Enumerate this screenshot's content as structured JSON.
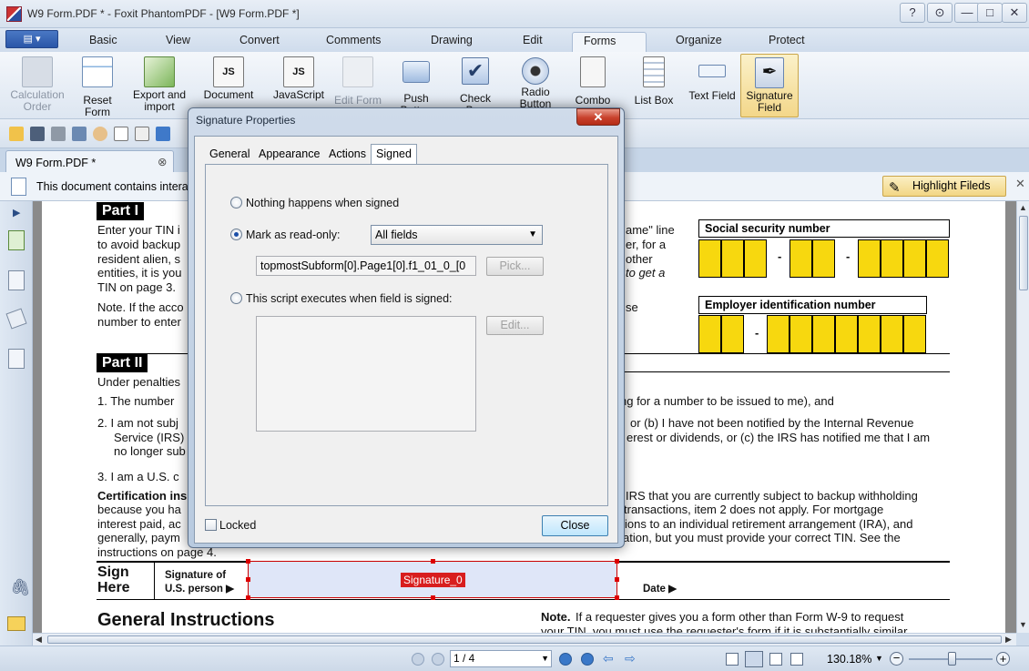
{
  "window": {
    "title": "W9 Form.PDF * - Foxit PhantomPDF - [W9 Form.PDF *]",
    "help": "?",
    "restore_small": "⊙",
    "minimize": "—",
    "maximize": "□",
    "close": "✕"
  },
  "menu": {
    "app_button": "▤ ▾",
    "tabs": [
      "Basic",
      "View",
      "Convert",
      "Comments",
      "Drawing",
      "Edit",
      "Forms",
      "Organize",
      "Protect"
    ],
    "active": "Forms"
  },
  "ribbon": [
    {
      "label": "Calculation Order",
      "icon": "calculation-order-icon",
      "disabled": true
    },
    {
      "label": "Reset Form",
      "icon": "reset-form-icon"
    },
    {
      "label": "Export and import",
      "icon": "export-import-icon"
    },
    {
      "label": "Document JavaScript",
      "icon": "document-js-icon"
    },
    {
      "label": "JavaScript Console",
      "icon": "javascript-icon"
    },
    {
      "label": "Edit Form",
      "icon": "edit-form-icon",
      "disabled": true
    },
    {
      "label": "Push Button",
      "icon": "push-button-icon"
    },
    {
      "label": "Check Box",
      "icon": "check-box-icon"
    },
    {
      "label": "Radio Button",
      "icon": "radio-button-icon"
    },
    {
      "label": "Combo Box",
      "icon": "combo-box-icon"
    },
    {
      "label": "List Box",
      "icon": "list-box-icon"
    },
    {
      "label": "Text Field",
      "icon": "text-field-icon"
    },
    {
      "label": "Signature Field",
      "icon": "signature-field-icon",
      "selected": true
    }
  ],
  "doc_tab": {
    "label": "W9 Form.PDF *",
    "close": "⊗"
  },
  "message_bar": {
    "text": "This document contains intera",
    "highlight_button": "Highlight Fileds",
    "close": "✕"
  },
  "pdf": {
    "part1": "Part I",
    "part1_text": [
      "Enter your TIN i",
      "to avoid backup",
      "resident alien, s",
      "entities, it is you",
      "TIN on page 3."
    ],
    "part1_right": [
      "ame\" line",
      "er, for a",
      "other",
      "to get a"
    ],
    "note1": [
      "Note. If the acco",
      "number to enter"
    ],
    "note1_right": "se",
    "ssn_label": "Social security number",
    "ein_label": "Employer identification number",
    "dash": "-",
    "part2": "Part II",
    "under": "Under penalties",
    "item1": "1.  The number",
    "item1_right": "ng for a number to be issued to me), and",
    "item2": [
      "2.  I am not subj",
      "Service (IRS)",
      "no longer sub"
    ],
    "item2_right": [
      "or (b) I have not been notified by the Internal Revenue",
      "erest or dividends, or (c) the IRS has notified me that I am"
    ],
    "item3": "3.  I am a U.S. c",
    "cert": [
      "Certification ins",
      "because you ha",
      "interest paid, ac",
      "generally, paym",
      "instructions on page 4."
    ],
    "cert_right": [
      "IRS that you are currently subject to backup withholding",
      "transactions, item 2 does not apply. For mortgage",
      "ions to an individual retirement arrangement (IRA), and",
      "ation, but you must provide your correct TIN. See the"
    ],
    "sign_here": [
      "Sign",
      "Here"
    ],
    "sig_of": [
      "Signature of",
      "U.S. person ▶"
    ],
    "date": "Date ▶",
    "sig_field": "Signature_0",
    "general": "General Instructions",
    "note2": "If a requester gives you a form other than Form W-9 to request",
    "note2_bold": "Note.",
    "note2_cut": "your TIN, you must use the requester's form if it is substantially similar"
  },
  "dialog": {
    "title": "Signature Properties",
    "close": "✕",
    "tabs": [
      "General",
      "Appearance",
      "Actions",
      "Signed"
    ],
    "active_tab": "Signed",
    "opt_nothing": "Nothing happens when signed",
    "opt_readonly": "Mark as read-only:",
    "readonly_value": "All fields",
    "fields_value": "topmostSubform[0].Page1[0].f1_01_0_[0",
    "pick": "Pick...",
    "opt_script": "This script executes when field is signed:",
    "edit": "Edit...",
    "locked": "Locked",
    "close_button": "Close"
  },
  "status": {
    "page": "1 / 4",
    "zoom": "130.18%"
  }
}
